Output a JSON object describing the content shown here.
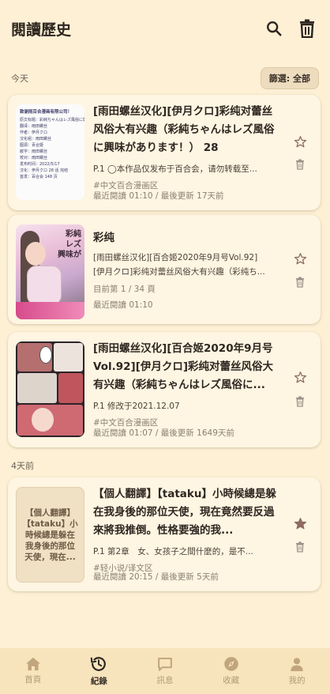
{
  "appbar": {
    "title": "閱讀歷史"
  },
  "filter": {
    "label": "篩選: 全部"
  },
  "sections": {
    "today": "今天",
    "four_days_ago": "4天前"
  },
  "items": [
    {
      "title": "[雨田螺丝汉化][伊月クロ]彩纯对蕾丝风俗大有兴趣（彩純ちゃんはレズ風俗に興味があります！） 28",
      "line1": "P.1 ◯本作品仅发布于百合会，请勿转载至...",
      "tag": "#中文百合漫画区",
      "meta": "最近閱讀 01:10 / 最後更新 17天前",
      "thumb_lines": [
        "致谢雨百合漫画有限公司！",
        "原文标题：彩純ちゃんはレズ風俗に興味",
        "翻译：雨田螺丝",
        "作者：伊月クロ",
        "汉化组：雨田螺丝",
        "图源：百合姬",
        "嵌字：雨田螺丝",
        "校对：雨田螺丝",
        "发布时间：2022/5/17",
        "汉化：伊月クロ 28 话 完结",
        "首发：百合会 148 页"
      ]
    },
    {
      "title": "彩纯",
      "line1": "[雨田螺丝汉化][百合姬2020年9月号Vol.92]",
      "line2": "[伊月クロ]彩纯对蕾丝风俗大有兴趣（彩纯ち...",
      "meta1": "目前第 1 / 34 頁",
      "meta": "最近閱讀 01:10",
      "thumb_text": [
        "彩純",
        "レズ",
        "興味が"
      ]
    },
    {
      "title": "[雨田螺丝汉化][百合姬2020年9月号Vol.92][伊月クロ]彩纯对蕾丝风俗大有兴趣（彩純ちゃんはレズ風俗に...",
      "line1": "P.1 修改于2021.12.07",
      "tag": "#中文百合漫画区",
      "meta": "最近閱讀 01:07 / 最後更新 1649天前"
    },
    {
      "title": "【個人翻譯】【tataku】小時候總是躲在我身後的那位天使，現在竟然要反過來將我推倒。性格要強的我...",
      "line1": "P.1 第2章　女、女孩子之間什麼的，是不...",
      "tag": "#轻小说/译文区",
      "meta": "最近閱讀 20:15 / 最後更新 5天前",
      "thumb_text": "【個人翻譯】【tataku】小時候總是躲在我身後的那位天使，現在..."
    }
  ],
  "nav": [
    {
      "label": "首頁",
      "icon": "home-icon"
    },
    {
      "label": "紀錄",
      "icon": "history-icon"
    },
    {
      "label": "訊息",
      "icon": "message-icon"
    },
    {
      "label": "收藏",
      "icon": "compass-icon"
    },
    {
      "label": "我的",
      "icon": "person-icon"
    }
  ],
  "colors": {
    "background": "#fdf0d5",
    "card": "#fef5e2",
    "nav": "#f7e4bd",
    "muted": "#8a7f72",
    "accent_star": "#8d6b5e"
  }
}
